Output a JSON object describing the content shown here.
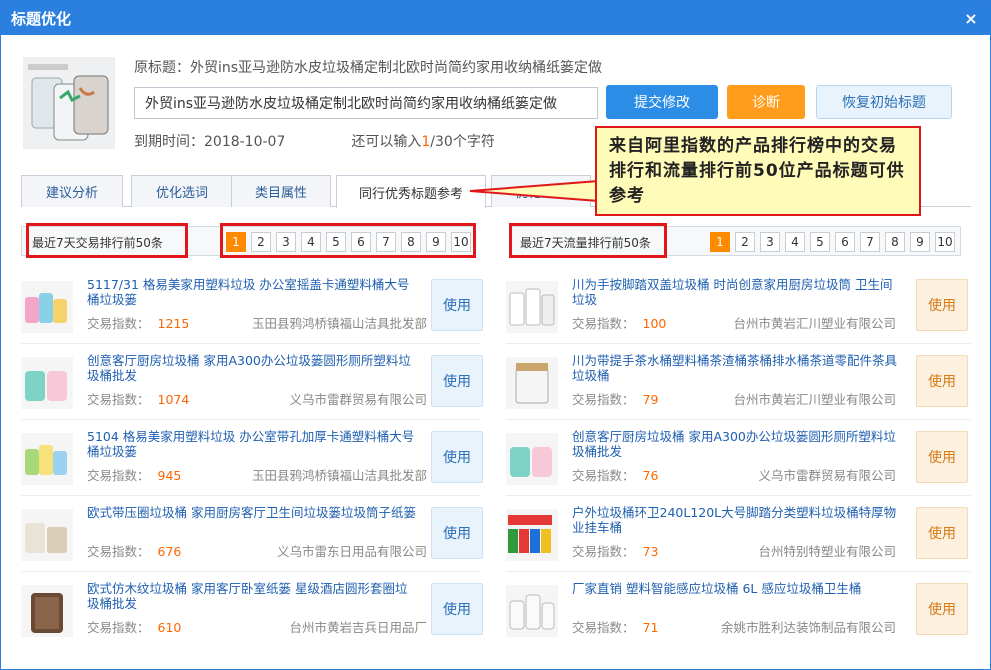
{
  "dialog": {
    "title": "标题优化",
    "close": "×"
  },
  "original": {
    "label": "原标题：",
    "text": "外贸ins亚马逊防水皮垃圾桶定制北欧时尚简约家用收纳桶纸篓定做"
  },
  "title_input": {
    "value": "外贸ins亚马逊防水皮垃圾桶定制北欧时尚简约家用收纳桶纸篓定做"
  },
  "buttons": {
    "submit": "提交修改",
    "diagnose": "诊断",
    "restore": "恢复初始标题"
  },
  "expiry": {
    "label": "到期时间：",
    "date": "2018-10-07"
  },
  "counter": {
    "prefix": "还可以输入",
    "current": "1",
    "suffix": "/30个字符"
  },
  "tabs": [
    "建议分析",
    "优化选词",
    "类目属性",
    "同行优秀标题参考",
    "优化记录"
  ],
  "left_list": {
    "header": "最近7天交易排行前50条",
    "pages": [
      "1",
      "2",
      "3",
      "4",
      "5",
      "6",
      "7",
      "8",
      "9",
      "10"
    ],
    "metric_label": "交易指数：",
    "items": [
      {
        "title": "5117/31 格易美家用塑料垃圾 办公室摇盖卡通塑料桶大号桶垃圾篓",
        "value": "1215",
        "shop": "玉田县鸦鸿桥镇福山洁具批发部",
        "use": "使用"
      },
      {
        "title": "创意客厅厨房垃圾桶 家用A300办公垃圾篓圆形厕所塑料垃圾桶批发",
        "value": "1074",
        "shop": "义乌市雷群贸易有限公司",
        "use": "使用"
      },
      {
        "title": "5104 格易美家用塑料垃圾 办公室带孔加厚卡通塑料桶大号桶垃圾篓",
        "value": "945",
        "shop": "玉田县鸦鸿桥镇福山洁具批发部",
        "use": "使用"
      },
      {
        "title": "欧式带压圈垃圾桶 家用厨房客厅卫生间垃圾篓垃圾筒子纸篓",
        "value": "676",
        "shop": "义乌市雷东日用品有限公司",
        "use": "使用"
      },
      {
        "title": "欧式仿木纹垃圾桶 家用客厅卧室纸篓 星级酒店圆形套圈垃圾桶批发",
        "value": "610",
        "shop": "台州市黄岩吉兵日用品厂",
        "use": "使用"
      }
    ]
  },
  "right_list": {
    "header": "最近7天流量排行前50条",
    "pages": [
      "1",
      "2",
      "3",
      "4",
      "5",
      "6",
      "7",
      "8",
      "9",
      "10"
    ],
    "metric_label": "交易指数：",
    "items": [
      {
        "title": "川为手按脚踏双盖垃圾桶 时尚创意家用厨房垃圾筒 卫生间垃圾",
        "value": "100",
        "shop": "台州市黄岩汇川塑业有限公司",
        "use": "使用"
      },
      {
        "title": "川为带提手茶水桶塑料桶茶渣桶茶桶排水桶茶道零配件茶具垃圾桶",
        "value": "79",
        "shop": "台州市黄岩汇川塑业有限公司",
        "use": "使用"
      },
      {
        "title": "创意客厅厨房垃圾桶 家用A300办公垃圾篓圆形厕所塑料垃圾桶批发",
        "value": "76",
        "shop": "义乌市雷群贸易有限公司",
        "use": "使用"
      },
      {
        "title": "户外垃圾桶环卫240L120L大号脚踏分类塑料垃圾桶特厚物业挂车桶",
        "value": "73",
        "shop": "台州特别特塑业有限公司",
        "use": "使用"
      },
      {
        "title": "厂家直销 塑料智能感应垃圾桶 6L 感应垃圾桶卫生桶",
        "value": "71",
        "shop": "余姚市胜利达装饰制品有限公司",
        "use": "使用"
      }
    ]
  },
  "callout": {
    "text": "来自阿里指数的产品排行榜中的交易排行和流量排行前50位产品标题可供参考"
  },
  "colors": {
    "primary": "#2a7fdf",
    "orange": "#ff9c1b",
    "annotation": "#e0181a"
  }
}
